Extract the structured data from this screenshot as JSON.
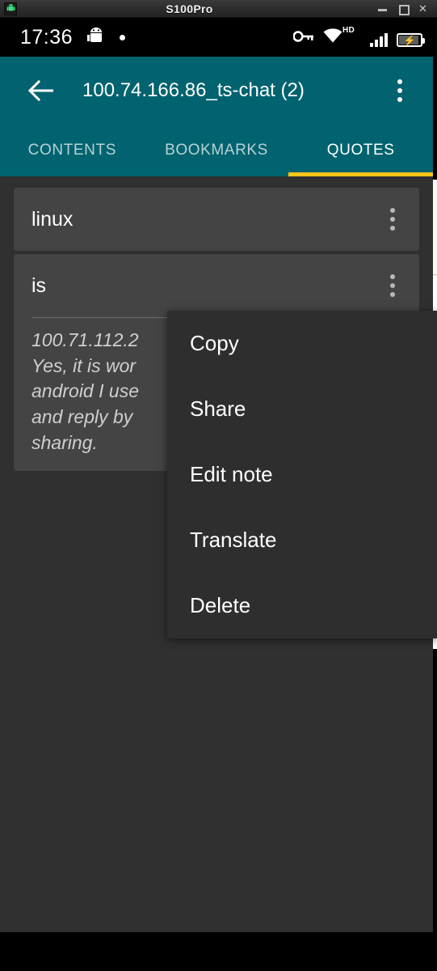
{
  "window": {
    "title": "S100Pro",
    "icon": "android-head-icon",
    "controls": {
      "minimize": "minimize-button",
      "maximize": "maximize-button",
      "close": "✕"
    }
  },
  "status_bar": {
    "clock": "17:36",
    "icons": [
      "android-debug-icon",
      "dot-icon",
      "vpn-key-icon",
      "wifi-icon",
      "signal-bars-icon",
      "battery-charging-icon"
    ],
    "network_label": "HD"
  },
  "app_bar": {
    "back_icon": "arrow-back-icon",
    "title": "100.74.166.86_ts-chat (2)",
    "overflow_icon": "overflow-menu-icon"
  },
  "tabs": {
    "items": [
      {
        "label": "CONTENTS",
        "active": false
      },
      {
        "label": "BOOKMARKS",
        "active": false
      },
      {
        "label": "QUOTES",
        "active": true
      }
    ],
    "indicator_color": "#ffc61a"
  },
  "quotes": [
    {
      "title": "linux",
      "note": "",
      "menu_icon": "overflow-menu-icon"
    },
    {
      "title": "is",
      "note": "100.71.112.2\nYes, it is wor\nandroid I use\nand reply by\nsharing.",
      "menu_icon": "overflow-menu-icon"
    }
  ],
  "context_menu": {
    "items": [
      "Copy",
      "Share",
      "Edit note",
      "Translate",
      "Delete"
    ]
  },
  "colors": {
    "app_bar": "#00636f",
    "accent": "#ffc61a",
    "page_background": "#303030",
    "card_background": "#444444",
    "menu_background": "#2e2e2e"
  }
}
